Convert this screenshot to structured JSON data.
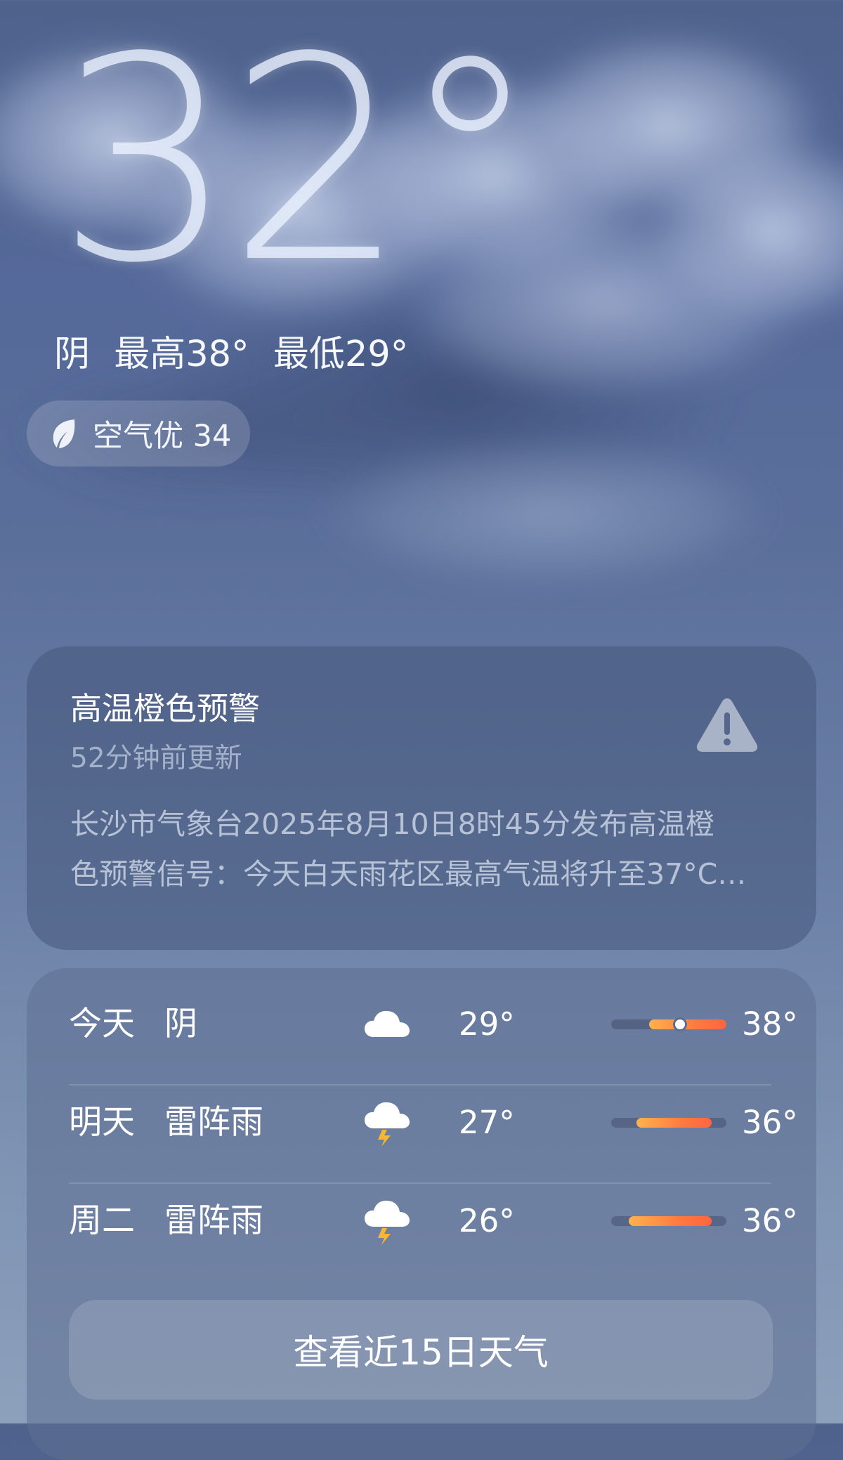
{
  "current": {
    "temperature": "32°",
    "condition": "阴",
    "high": "最高38°",
    "low": "最低29°"
  },
  "air_quality": {
    "label": "空气优 34",
    "icon": "leaf-icon"
  },
  "alert": {
    "title": "高温橙色预警",
    "updated": "52分钟前更新",
    "body_line1": "长沙市气象台2025年8月10日8时45分发布高温橙",
    "body_line2": "色预警信号：今天白天雨花区最高气温将升至37°C…",
    "icon": "warning-triangle-icon",
    "icon_color": "#a9b3c8"
  },
  "forecast": {
    "rows": [
      {
        "day": "今天",
        "condition": "阴",
        "icon": "cloud-icon",
        "low": "29°",
        "high": "38°",
        "range_start": 0.33,
        "range_end": 1.0,
        "current_marker": 0.6
      },
      {
        "day": "明天",
        "condition": "雷阵雨",
        "icon": "thunderstorm-icon",
        "low": "27°",
        "high": "36°",
        "range_start": 0.22,
        "range_end": 0.87
      },
      {
        "day": "周二",
        "condition": "雷阵雨",
        "icon": "thunderstorm-icon",
        "low": "26°",
        "high": "36°",
        "range_start": 0.15,
        "range_end": 0.87
      }
    ],
    "more_button": "查看近15日天气"
  },
  "colors": {
    "range_start": "#ffb24d",
    "range_end": "#ff6540",
    "lightning": "#f5b82e"
  }
}
